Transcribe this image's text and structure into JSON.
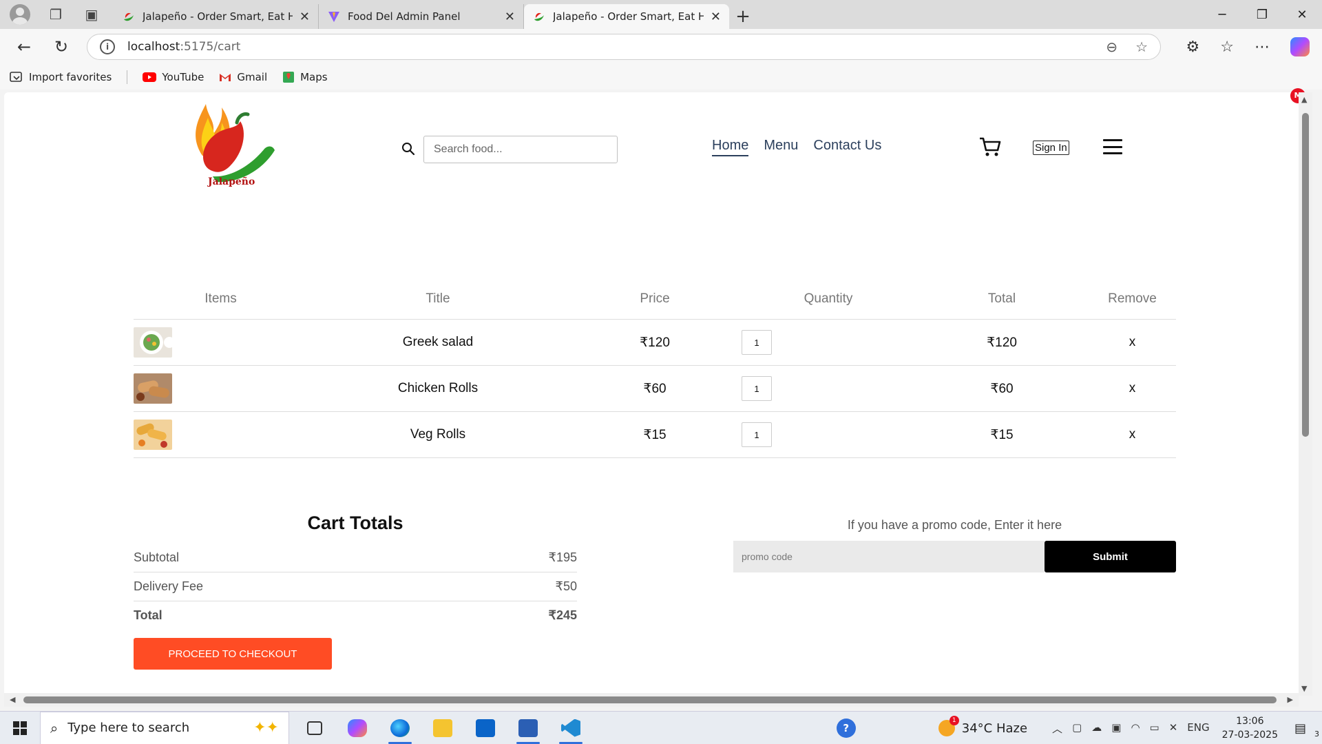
{
  "browser": {
    "tabs": [
      {
        "title": "Jalapeño - Order Smart, Eat Healt",
        "active": false
      },
      {
        "title": "Food Del Admin Panel",
        "active": false
      },
      {
        "title": "Jalapeño - Order Smart, Eat Healt",
        "active": true
      }
    ],
    "url_host": "localhost",
    "url_rest": ":5175/cart",
    "favorites": [
      {
        "label": "Import favorites"
      },
      {
        "label": "YouTube"
      },
      {
        "label": "Gmail"
      },
      {
        "label": "Maps"
      }
    ],
    "notification_badge": "M"
  },
  "header": {
    "logo_text": "Jalapeño",
    "search_placeholder": "Search food...",
    "nav": [
      "Home",
      "Menu",
      "Contact Us"
    ],
    "signin_label": "Sign In"
  },
  "cart": {
    "columns": [
      "Items",
      "Title",
      "Price",
      "Quantity",
      "Total",
      "Remove"
    ],
    "rows": [
      {
        "title": "Greek salad",
        "price": "₹120",
        "quantity": "1",
        "total": "₹120",
        "remove": "x"
      },
      {
        "title": "Chicken Rolls",
        "price": "₹60",
        "quantity": "1",
        "total": "₹60",
        "remove": "x"
      },
      {
        "title": "Veg Rolls",
        "price": "₹15",
        "quantity": "1",
        "total": "₹15",
        "remove": "x"
      }
    ]
  },
  "totals": {
    "heading": "Cart Totals",
    "subtotal_label": "Subtotal",
    "subtotal_value": "₹195",
    "delivery_label": "Delivery Fee",
    "delivery_value": "₹50",
    "total_label": "Total",
    "total_value": "₹245",
    "checkout_label": "PROCEED TO CHECKOUT"
  },
  "promo": {
    "prompt": "If you have a promo code, Enter it here",
    "placeholder": "promo code",
    "submit_label": "Submit"
  },
  "taskbar": {
    "search_placeholder": "Type here to search",
    "weather": "34°C  Haze",
    "weather_badge": "1",
    "language": "ENG",
    "time": "13:06",
    "date": "27-03-2025",
    "notification_count": "3"
  }
}
